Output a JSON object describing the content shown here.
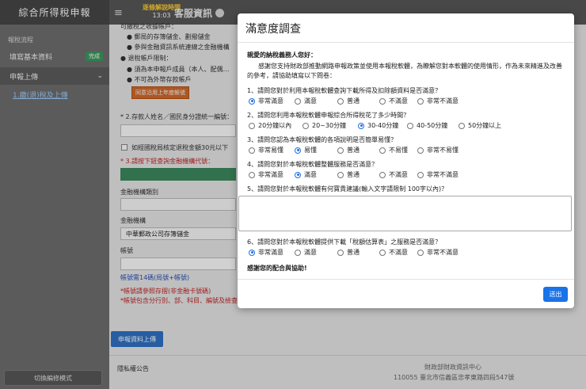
{
  "app": {
    "title": "綜合所得稅申報",
    "timer_label": "逐條解說時間",
    "timer_value": "13:03",
    "service_label": "客服資訊"
  },
  "sidebar": {
    "section_label": "報稅流程",
    "items": [
      {
        "label": "填寫基本資料",
        "badge": "完成"
      },
      {
        "label": "申報上傳"
      }
    ],
    "sub_item": "1.繳(退)稅及上傳",
    "edit_mode_button": "切換編修模式"
  },
  "background": {
    "bullets": [
      "可繳稅之收據帳戶：",
      "● 郵局的存簿儲金、劃撥儲金",
      "● 參與金融資訊系統連線之金融機構",
      "● 退稅帳戶限制：",
      "● 須為本申報戶成員（本人、配偶…",
      "● 不可為外幣存款帳戶"
    ],
    "warn_button": "同意沿用上年度帳號",
    "field2_label": "* 2.存款人姓名／國民身分證統一編號：",
    "checkbox_label": "如經國稅局核定退稅金額30元以下",
    "field3_label": "* 3.請按下鈕查詢金融機構代號：",
    "bank_type_label": "金融機構類別",
    "bank_label": "金融機構",
    "bank_value": "中華郵政公司存簿儲金",
    "account_label": "帳號",
    "account_hint": "帳號需14碼(局號+帳號)",
    "red_note1": "*帳號請參照存摺(非金融卡號碼)",
    "red_note2": "*帳號包含分行別、部、科目、編號及檢查號碼",
    "upload_button": "申報資料上傳",
    "privacy": "隱私權公告",
    "footer_org": "財政部財政資訊中心",
    "footer_addr": "110055 臺北市信義區忠孝東路四段547號"
  },
  "modal": {
    "title": "滿意度調查",
    "greeting": "親愛的納稅義務人您好：",
    "intro": "感謝您支持財政部推動網路申報政策並使用本報稅軟體，為瞭解您對本軟體的使用情形，作為未來精進及改善的參考，請協助填寫以下問卷：",
    "questions": [
      {
        "label": "1、請問您對於利用本報稅軟體查詢下載所得及扣除額資料是否滿意？",
        "options": [
          "非常滿意",
          "滿意",
          "普通",
          "不滿意",
          "非常不滿意"
        ],
        "selected": 0
      },
      {
        "label": "2、請問您利用本報稅軟體申報綜合所得稅花了多少時間？",
        "options": [
          "20分鐘以內",
          "20~30分鐘",
          "30-40分鐘",
          "40-50分鐘",
          "50分鐘以上"
        ],
        "selected": 2
      },
      {
        "label": "3、請問您認為本報稅軟體的各項說明是否簡單易懂？",
        "options": [
          "非常易懂",
          "易懂",
          "普通",
          "不易懂",
          "非常不易懂"
        ],
        "selected": 1
      },
      {
        "label": "4、請問您對於本報稅軟體整體服務是否滿意？",
        "options": [
          "非常滿意",
          "滿意",
          "普通",
          "不滿意",
          "非常不滿意"
        ],
        "selected": 1
      }
    ],
    "q5_label": "5、請問您對於本報稅軟體有何寶貴建議(輸入文字請限制 100字以內)？",
    "q6": {
      "label": "6、請問您對於本報稅軟體提供下載「稅額估算表」之服務是否滿意？",
      "options": [
        "非常滿意",
        "滿意",
        "普通",
        "不滿意",
        "非常不滿意"
      ],
      "selected": 0
    },
    "thanks": "感謝您的配合與協助!",
    "submit": "送出"
  }
}
